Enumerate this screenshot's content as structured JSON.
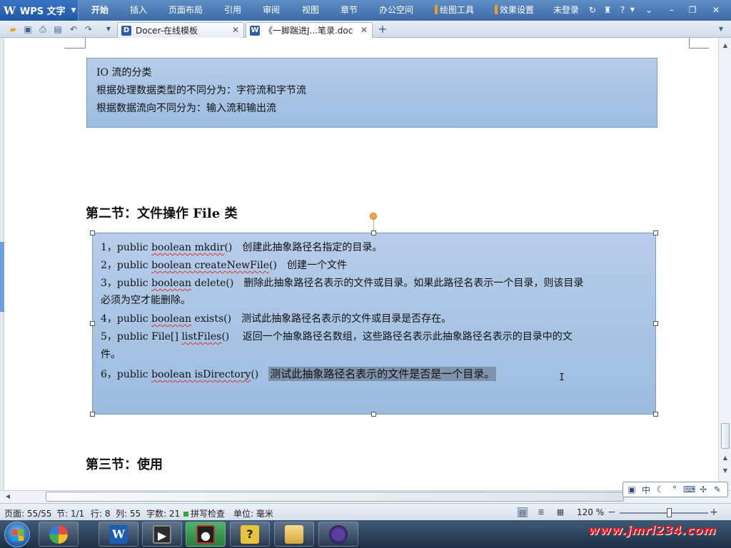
{
  "app": {
    "name": "WPS 文字",
    "logo_letter": "W",
    "ribbon_tabs": [
      "开始",
      "插入",
      "页面布局",
      "引用",
      "审阅",
      "视图",
      "章节",
      "办公空间"
    ],
    "context_tabs": [
      "绘图工具",
      "效果设置"
    ],
    "login_status": "未登录",
    "help": "?"
  },
  "tabs": [
    {
      "label": "Docer-在线模板"
    },
    {
      "label": "《一脚踹进J...笔录.doc"
    }
  ],
  "document": {
    "box1_lines": [
      "IO 流的分类",
      "根据处理数据类型的不同分为：字符流和字节流",
      "根据数据流向不同分为：输入流和输出流"
    ],
    "section2_heading": "第二节：文件操作 File 类",
    "box2": {
      "item1_prefix": "1，public ",
      "item1_squiggle": "boolean mkdir",
      "item1_rest": "()　创建此抽象路径名指定的目录。",
      "item2_prefix": "2，public ",
      "item2_squiggle": "boolean createNewFile",
      "item2_rest": "()　创建一个文件",
      "item3_prefix": "3，public ",
      "item3_squiggle": "boolean",
      "item3_rest": " delete()　删除此抽象路径名表示的文件或目录。如果此路径名表示一个目录，则该目录",
      "item3_cont": "必须为空才能删除。",
      "item4_prefix": "4，public ",
      "item4_squiggle": "boolean",
      "item4_rest": " exists()　测试此抽象路径名表示的文件或目录是否存在。",
      "item5_prefix": "5，public File[] ",
      "item5_squiggle": "listFiles",
      "item5_rest": "()　 返回一个抽象路径名数组，这些路径名表示此抽象路径名表示的目录中的文",
      "item5_cont": "件。",
      "item6_prefix": "6，public ",
      "item6_squiggle": "boolean isDirectory",
      "item6_rest": "()　",
      "item6_selected": "测试此抽象路径名表示的文件是否是一个目录。"
    },
    "section3_heading": "第三节：使用"
  },
  "ime": {
    "mode_label": "中"
  },
  "status": {
    "page": "页面: 55/55",
    "section": "节: 1/1",
    "row": "行: 8",
    "column": "列: 55",
    "word_count": "字数: 21",
    "spell_check": "拼写检查",
    "unit": "单位: 毫米",
    "zoom": "120 %",
    "zoom_level_fraction": 0.56
  },
  "watermark": "www.jmrl234.com",
  "colors": {
    "ribbon": "#3c6aa7",
    "textbox_fill": "#a9c5e6",
    "selection": "#7f93ad",
    "watermark": "#e8161a"
  }
}
